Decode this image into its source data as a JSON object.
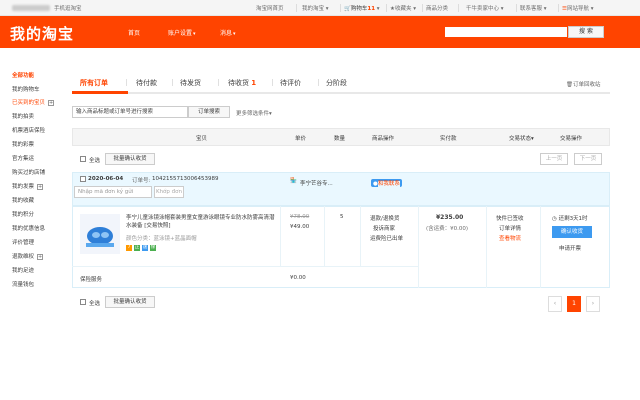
{
  "topbar": {
    "mobile": "手机逛淘宝",
    "links": [
      "淘宝网首页",
      "我的淘宝",
      "购物车",
      "收藏夹",
      "商品分类",
      "千牛卖家中心",
      "联系客服",
      "网站导航"
    ],
    "cart_count": "11"
  },
  "header": {
    "logo": "我的淘宝",
    "nav": [
      "首页",
      "账户设置",
      "消息"
    ],
    "search_button": "搜 索"
  },
  "sidebar": {
    "all": "全部功能",
    "items": [
      "我的购物车",
      "已买到的宝贝",
      "我的拍卖",
      "机票酒店保险",
      "我的彩票",
      "官方集运",
      "购买过的店铺",
      "我的发票",
      "我的收藏",
      "我的积分",
      "我的优惠信息",
      "评价管理",
      "退款维权",
      "我的足迹",
      "流量钱包"
    ]
  },
  "tabs": {
    "items": [
      "所有订单",
      "待付款",
      "待发货",
      "待收货",
      "待评价",
      "分阶段"
    ],
    "pending_receive_count": "1",
    "recycle": "订单回收站"
  },
  "search": {
    "placeholder": "输入商品标题或订单号进行搜索",
    "button": "订单搜索",
    "more": "更多筛选条件"
  },
  "columns": [
    "宝贝",
    "单价",
    "数量",
    "商品操作",
    "实付款",
    "交易状态",
    "交易操作"
  ],
  "bulk": {
    "select_all": "全选",
    "confirm": "批量确认收货",
    "prev": "上一页",
    "next": "下一页"
  },
  "order": {
    "date": "2020-06-04",
    "order_no_label": "订单号:",
    "order_no": "1042155713006453989",
    "shop": "李宁芒谷专...",
    "contact": "和我联系",
    "translate_input": "Nhập mã đơn ký gửi",
    "translate_button": "Khớp đơn",
    "title": "李宁儿童泳镜泳帽套装男童女童游泳眼镜专业防水防雾高清潜水装备 [交易快照]",
    "sku": "颜色分类：蓝泳镜+蓝晶面帽",
    "price_original": "¥78.00",
    "price": "¥49.00",
    "quantity": "5",
    "ops": [
      "退款/退换货",
      "投诉商家",
      "运费险已出单"
    ],
    "total": "¥235.00",
    "shipping": "(含运费：¥0.00)",
    "status": [
      "快件已签收",
      "订单详情",
      "查看物流"
    ],
    "remaining": "还剩3天1时",
    "confirm_button": "确认收货",
    "extend": "申请开票",
    "insurance": "保险服务",
    "insurance_price": "¥0.00"
  },
  "pagination": {
    "current": "1"
  },
  "colors": {
    "brand": "#ff4400",
    "confirm": "#3d9af0",
    "order_head": "#eaf8ff"
  }
}
